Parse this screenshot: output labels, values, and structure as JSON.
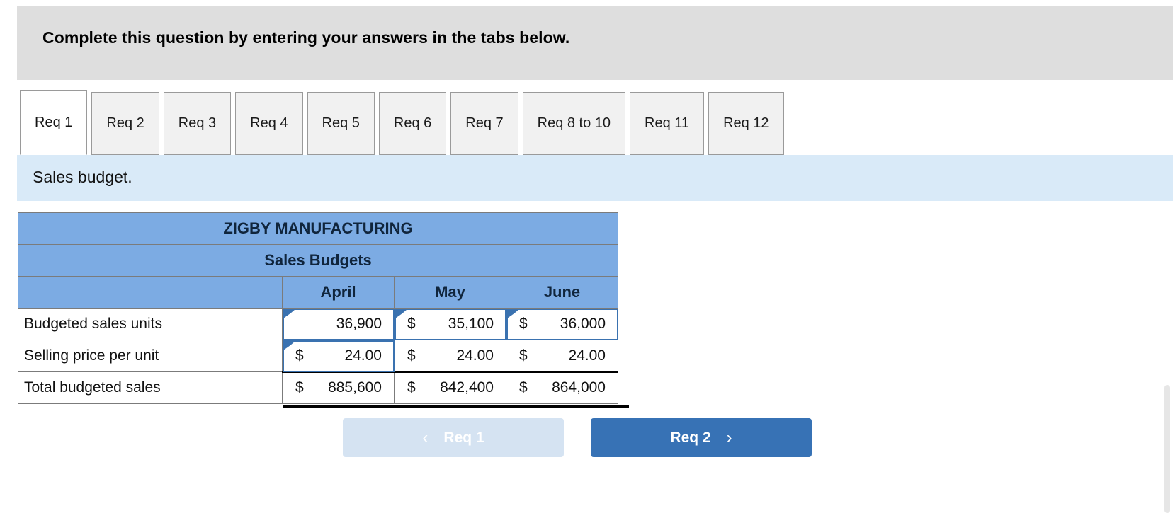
{
  "banner": {
    "text": "Complete this question by entering your answers in the tabs below."
  },
  "tabs": [
    {
      "label": "Req 1",
      "active": true
    },
    {
      "label": "Req 2",
      "active": false
    },
    {
      "label": "Req 3",
      "active": false
    },
    {
      "label": "Req 4",
      "active": false
    },
    {
      "label": "Req 5",
      "active": false
    },
    {
      "label": "Req 6",
      "active": false
    },
    {
      "label": "Req 7",
      "active": false
    },
    {
      "label": "Req 8 to 10",
      "active": false
    },
    {
      "label": "Req 11",
      "active": false
    },
    {
      "label": "Req 12",
      "active": false
    }
  ],
  "subheader": {
    "text": "Sales budget."
  },
  "table": {
    "company": "ZIGBY MANUFACTURING",
    "title": "Sales Budgets",
    "corner_blank": "",
    "columns": [
      "April",
      "May",
      "June"
    ],
    "rows": [
      {
        "label": "Budgeted sales units",
        "cells": [
          {
            "symbol": "",
            "value": "36,900",
            "selected": true,
            "marker": true
          },
          {
            "symbol": "$",
            "value": "35,100",
            "selected": true,
            "marker": true
          },
          {
            "symbol": "$",
            "value": "36,000",
            "selected": true,
            "marker": true
          }
        ]
      },
      {
        "label": "Selling price per unit",
        "cells": [
          {
            "symbol": "$",
            "value": "24.00",
            "selected": true,
            "marker": true
          },
          {
            "symbol": "$",
            "value": "24.00",
            "selected": false,
            "marker": false
          },
          {
            "symbol": "$",
            "value": "24.00",
            "selected": false,
            "marker": false
          }
        ]
      },
      {
        "label": "Total budgeted sales",
        "total": true,
        "cells": [
          {
            "symbol": "$",
            "value": "885,600",
            "selected": false,
            "marker": false
          },
          {
            "symbol": "$",
            "value": "842,400",
            "selected": false,
            "marker": false
          },
          {
            "symbol": "$",
            "value": "864,000",
            "selected": false,
            "marker": false
          }
        ]
      }
    ]
  },
  "nav": {
    "prev_label": "Req 1",
    "prev_chevron": "‹",
    "next_label": "Req 2",
    "next_chevron": "›"
  },
  "colors": {
    "banner_bg": "#dedede",
    "subband_bg": "#d9eaf8",
    "table_header_blue": "#7cabe3",
    "cell_select_blue": "#3a72b0",
    "next_button_blue": "#3772b5",
    "prev_button_blue": "#d5e3f2"
  }
}
